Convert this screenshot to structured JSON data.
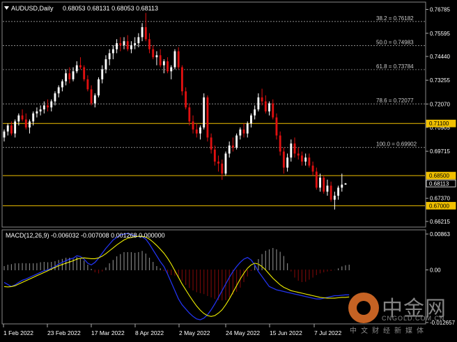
{
  "header": {
    "symbol": "AUDUSD,Daily",
    "ohlc": "0.68053 0.68131 0.68053 0.68113"
  },
  "macd_header": "MACD(12,26,9) -0.006032 -0.007008 0.001268 0.000000",
  "colors": {
    "background": "#000000",
    "bull": "#ffffff",
    "bear": "#e01010",
    "level_line": "#f0c000",
    "fib_line": "#bbbbbb",
    "macd_line": "#2233ee",
    "signal_line": "#f0f000",
    "hist_pos": "#ffffff",
    "hist_neg": "#e01010"
  },
  "price_axis_labels": [
    "0.76785",
    "0.75595",
    "0.74440",
    "0.73255",
    "0.72070",
    "0.70905",
    "0.69715",
    "0.67370",
    "0.66215"
  ],
  "level_labels": [
    "0.71100",
    "0.68500",
    "0.68113",
    "0.67000"
  ],
  "fib_labels": [
    "38.2 = 0.76182",
    "50.0 = 0.74983",
    "61.8 = 0.73784",
    "78.6 = 0.72077",
    "100.0 = 0.69902"
  ],
  "macd_axis_labels": [
    "0.00863",
    "0.00",
    "-0.012657"
  ],
  "date_labels": [
    "1 Feb 2022",
    "23 Feb 2022",
    "17 Mar 2022",
    "8 Apr 2022",
    "2 May 2022",
    "24 May 2022",
    "15 Jun 2022",
    "7 Jul 2022"
  ],
  "watermark": {
    "brand": "中金网",
    "url": "CNGOLD.COM.CN",
    "tagline": "中文财经新媒体"
  },
  "chart_data": {
    "type": "candlestick",
    "ylim": [
      0.6597,
      0.7708
    ],
    "macd_ylim": [
      -0.012657,
      0.00863
    ],
    "fib_levels": [
      0.76182,
      0.74983,
      0.73784,
      0.72077,
      0.69902
    ],
    "levels": [
      0.711,
      0.685,
      0.67
    ],
    "last_price": 0.68113,
    "candles": [
      [
        0.704,
        0.708,
        0.702,
        0.707
      ],
      [
        0.707,
        0.711,
        0.705,
        0.71
      ],
      [
        0.71,
        0.712,
        0.705,
        0.706
      ],
      [
        0.706,
        0.713,
        0.704,
        0.712
      ],
      [
        0.712,
        0.716,
        0.71,
        0.715
      ],
      [
        0.715,
        0.718,
        0.712,
        0.713
      ],
      [
        0.713,
        0.716,
        0.708,
        0.709
      ],
      [
        0.709,
        0.713,
        0.706,
        0.712
      ],
      [
        0.712,
        0.717,
        0.71,
        0.716
      ],
      [
        0.716,
        0.719,
        0.714,
        0.717
      ],
      [
        0.717,
        0.72,
        0.715,
        0.718
      ],
      [
        0.718,
        0.722,
        0.716,
        0.72
      ],
      [
        0.72,
        0.723,
        0.717,
        0.719
      ],
      [
        0.719,
        0.723,
        0.717,
        0.722
      ],
      [
        0.722,
        0.727,
        0.72,
        0.726
      ],
      [
        0.726,
        0.73,
        0.724,
        0.729
      ],
      [
        0.729,
        0.733,
        0.727,
        0.732
      ],
      [
        0.732,
        0.738,
        0.73,
        0.736
      ],
      [
        0.736,
        0.739,
        0.731,
        0.733
      ],
      [
        0.733,
        0.739,
        0.732,
        0.737
      ],
      [
        0.737,
        0.742,
        0.736,
        0.74
      ],
      [
        0.74,
        0.744,
        0.738,
        0.739
      ],
      [
        0.739,
        0.74,
        0.732,
        0.733
      ],
      [
        0.733,
        0.735,
        0.727,
        0.728
      ],
      [
        0.728,
        0.73,
        0.72,
        0.721
      ],
      [
        0.721,
        0.726,
        0.719,
        0.725
      ],
      [
        0.725,
        0.734,
        0.724,
        0.733
      ],
      [
        0.733,
        0.74,
        0.731,
        0.738
      ],
      [
        0.738,
        0.745,
        0.736,
        0.743
      ],
      [
        0.743,
        0.748,
        0.74,
        0.746
      ],
      [
        0.746,
        0.75,
        0.743,
        0.748
      ],
      [
        0.748,
        0.753,
        0.746,
        0.751
      ],
      [
        0.751,
        0.754,
        0.747,
        0.75
      ],
      [
        0.75,
        0.754,
        0.748,
        0.752
      ],
      [
        0.752,
        0.755,
        0.747,
        0.748
      ],
      [
        0.748,
        0.752,
        0.746,
        0.75
      ],
      [
        0.75,
        0.754,
        0.748,
        0.751
      ],
      [
        0.751,
        0.756,
        0.749,
        0.754
      ],
      [
        0.754,
        0.761,
        0.752,
        0.759
      ],
      [
        0.759,
        0.7661,
        0.752,
        0.753
      ],
      [
        0.753,
        0.756,
        0.746,
        0.748
      ],
      [
        0.748,
        0.75,
        0.743,
        0.744
      ],
      [
        0.744,
        0.747,
        0.74,
        0.745
      ],
      [
        0.745,
        0.748,
        0.739,
        0.74
      ],
      [
        0.74,
        0.743,
        0.736,
        0.742
      ],
      [
        0.742,
        0.744,
        0.736,
        0.737
      ],
      [
        0.737,
        0.74,
        0.733,
        0.739
      ],
      [
        0.739,
        0.748,
        0.738,
        0.747
      ],
      [
        0.747,
        0.749,
        0.738,
        0.739
      ],
      [
        0.739,
        0.74,
        0.725,
        0.727
      ],
      [
        0.727,
        0.729,
        0.718,
        0.719
      ],
      [
        0.719,
        0.721,
        0.71,
        0.712
      ],
      [
        0.712,
        0.715,
        0.706,
        0.708
      ],
      [
        0.708,
        0.711,
        0.704,
        0.706
      ],
      [
        0.706,
        0.71,
        0.703,
        0.709
      ],
      [
        0.709,
        0.726,
        0.708,
        0.724
      ],
      [
        0.724,
        0.725,
        0.702,
        0.704
      ],
      [
        0.704,
        0.706,
        0.696,
        0.698
      ],
      [
        0.698,
        0.7,
        0.69,
        0.692
      ],
      [
        0.692,
        0.695,
        0.687,
        0.691
      ],
      [
        0.691,
        0.693,
        0.6829,
        0.686
      ],
      [
        0.686,
        0.697,
        0.685,
        0.696
      ],
      [
        0.696,
        0.702,
        0.694,
        0.7
      ],
      [
        0.7,
        0.704,
        0.697,
        0.699
      ],
      [
        0.699,
        0.706,
        0.698,
        0.705
      ],
      [
        0.705,
        0.709,
        0.703,
        0.708
      ],
      [
        0.708,
        0.711,
        0.704,
        0.706
      ],
      [
        0.706,
        0.712,
        0.704,
        0.711
      ],
      [
        0.711,
        0.716,
        0.709,
        0.715
      ],
      [
        0.715,
        0.72,
        0.713,
        0.718
      ],
      [
        0.718,
        0.726,
        0.717,
        0.724
      ],
      [
        0.724,
        0.7283,
        0.72,
        0.722
      ],
      [
        0.722,
        0.725,
        0.716,
        0.717
      ],
      [
        0.717,
        0.722,
        0.715,
        0.721
      ],
      [
        0.721,
        0.723,
        0.713,
        0.714
      ],
      [
        0.714,
        0.716,
        0.703,
        0.705
      ],
      [
        0.705,
        0.707,
        0.695,
        0.697
      ],
      [
        0.697,
        0.699,
        0.686,
        0.689
      ],
      [
        0.689,
        0.696,
        0.687,
        0.694
      ],
      [
        0.694,
        0.703,
        0.692,
        0.701
      ],
      [
        0.701,
        0.704,
        0.694,
        0.696
      ],
      [
        0.696,
        0.699,
        0.693,
        0.695
      ],
      [
        0.695,
        0.697,
        0.69,
        0.692
      ],
      [
        0.692,
        0.696,
        0.69,
        0.694
      ],
      [
        0.694,
        0.696,
        0.689,
        0.69
      ],
      [
        0.69,
        0.692,
        0.685,
        0.687
      ],
      [
        0.687,
        0.689,
        0.678,
        0.679
      ],
      [
        0.679,
        0.686,
        0.677,
        0.684
      ],
      [
        0.684,
        0.685,
        0.676,
        0.677
      ],
      [
        0.677,
        0.683,
        0.675,
        0.68
      ],
      [
        0.68,
        0.682,
        0.672,
        0.673
      ],
      [
        0.673,
        0.677,
        0.6681,
        0.675
      ],
      [
        0.675,
        0.68,
        0.673,
        0.679
      ],
      [
        0.679,
        0.686,
        0.677,
        0.6805
      ],
      [
        0.6805,
        0.6813,
        0.6805,
        0.6811
      ]
    ],
    "macd": {
      "hist": [
        0.001,
        0.0012,
        0.0014,
        0.0015,
        0.0016,
        0.0017,
        0.0016,
        0.0015,
        0.0016,
        0.0017,
        0.0018,
        0.0019,
        0.0018,
        0.0019,
        0.0021,
        0.0024,
        0.0027,
        0.003,
        0.003,
        0.0029,
        0.0031,
        0.003,
        0.0022,
        0.0012,
        0.0002,
        -0.0006,
        -0.0008,
        -0.0004,
        0.0006,
        0.0016,
        0.0024,
        0.0032,
        0.0038,
        0.0042,
        0.0043,
        0.0042,
        0.0041,
        0.0042,
        0.0045,
        0.004,
        0.003,
        0.002,
        0.001,
        0.0004,
        -0.0002,
        -0.0008,
        -0.0012,
        -0.0014,
        -0.0018,
        -0.0026,
        -0.0036,
        -0.0044,
        -0.005,
        -0.0054,
        -0.0056,
        -0.0058,
        -0.0062,
        -0.0066,
        -0.007,
        -0.0072,
        -0.0074,
        -0.0072,
        -0.0066,
        -0.006,
        -0.0052,
        -0.0042,
        -0.003,
        -0.0016,
        -0.0002,
        0.0012,
        0.0026,
        0.0038,
        0.0046,
        0.005,
        0.0052,
        0.005,
        0.0044,
        0.0034,
        0.0016,
        -0.0004,
        -0.0018,
        -0.0026,
        -0.003,
        -0.0028,
        -0.0024,
        -0.0018,
        -0.0012,
        -0.0008,
        -0.0006,
        -0.0004,
        -0.0002,
        0.0,
        0.0004,
        0.0008,
        0.0011,
        0.0013
      ],
      "macd_line": [
        -0.003,
        -0.0035,
        -0.004,
        -0.0036,
        -0.003,
        -0.0025,
        -0.0022,
        -0.0018,
        -0.0014,
        -0.001,
        -0.0006,
        -0.0002,
        0.0,
        0.0004,
        0.0008,
        0.0014,
        0.0018,
        0.0022,
        0.0026,
        0.0028,
        0.0034,
        0.0032,
        0.0026,
        0.0016,
        0.0012,
        0.0018,
        0.0028,
        0.004,
        0.0052,
        0.0062,
        0.0072,
        0.0078,
        0.0084,
        0.0086,
        0.0088,
        0.0085,
        0.0082,
        0.008,
        0.008,
        0.0074,
        0.0062,
        0.0048,
        0.0034,
        0.002,
        0.0008,
        -0.001,
        -0.003,
        -0.005,
        -0.007,
        -0.0084,
        -0.0094,
        -0.0104,
        -0.0112,
        -0.0118,
        -0.012,
        -0.0116,
        -0.0108,
        -0.0096,
        -0.0082,
        -0.0066,
        -0.005,
        -0.0034,
        -0.0018,
        -0.0004,
        0.0008,
        0.0018,
        0.0026,
        0.003,
        0.0024,
        0.0012,
        -0.0004,
        -0.0016,
        -0.0028,
        -0.004,
        -0.0044,
        -0.0048,
        -0.005,
        -0.0052,
        -0.0054,
        -0.0056,
        -0.0058,
        -0.006,
        -0.0062,
        -0.0064,
        -0.0066,
        -0.0068,
        -0.007,
        -0.007,
        -0.0068,
        -0.0066,
        -0.0064,
        -0.0062,
        -0.0062,
        -0.0061,
        -0.006,
        -0.006
      ],
      "signal_line": [
        -0.004,
        -0.0041,
        -0.004,
        -0.0038,
        -0.0034,
        -0.003,
        -0.0026,
        -0.0022,
        -0.0018,
        -0.0014,
        -0.001,
        -0.0006,
        -0.0002,
        0.0002,
        0.0006,
        0.001,
        0.0013,
        0.0016,
        0.0019,
        0.0022,
        0.0026,
        0.0028,
        0.0029,
        0.0028,
        0.0027,
        0.0027,
        0.0029,
        0.0033,
        0.0039,
        0.0046,
        0.0053,
        0.006,
        0.0066,
        0.0072,
        0.0076,
        0.0078,
        0.008,
        0.0081,
        0.0081,
        0.0079,
        0.0074,
        0.0067,
        0.0059,
        0.005,
        0.004,
        0.0028,
        0.0014,
        -0.0002,
        -0.0018,
        -0.0034,
        -0.0048,
        -0.0062,
        -0.0075,
        -0.0087,
        -0.0097,
        -0.0105,
        -0.011,
        -0.0112,
        -0.011,
        -0.0104,
        -0.0096,
        -0.0084,
        -0.007,
        -0.0054,
        -0.0038,
        -0.0022,
        -0.0008,
        0.0004,
        0.0012,
        0.0016,
        0.0014,
        0.0008,
        0.0,
        -0.001,
        -0.002,
        -0.0028,
        -0.0036,
        -0.0042,
        -0.0046,
        -0.005,
        -0.0052,
        -0.0054,
        -0.0056,
        -0.0058,
        -0.006,
        -0.0062,
        -0.0064,
        -0.0066,
        -0.0067,
        -0.0068,
        -0.0068,
        -0.0068,
        -0.0067,
        -0.0066,
        -0.0066,
        -0.0065
      ]
    }
  }
}
